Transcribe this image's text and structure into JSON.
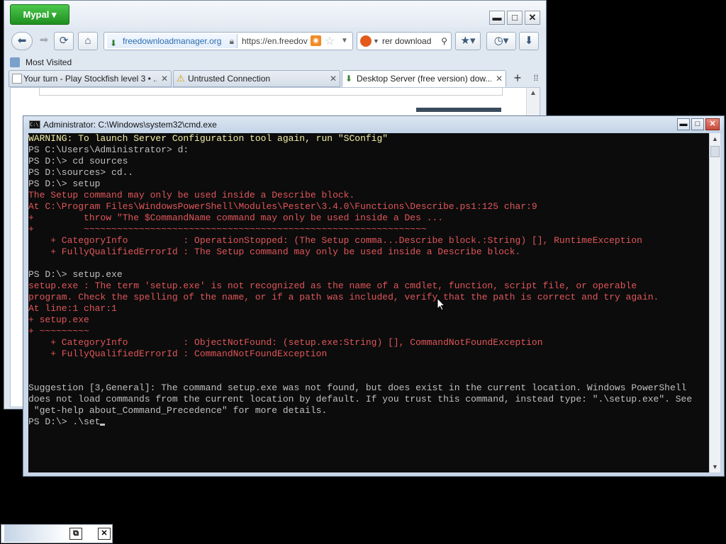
{
  "browser": {
    "app_button": "Mypal",
    "nav": {
      "site_label": "freedownloadmanager.org",
      "url": "https://en.freedov",
      "search_text": "rer download"
    },
    "bookmarks_toolbar": {
      "most_visited": "Most Visited"
    },
    "tabs": [
      {
        "label": "Your turn - Play Stockfish level 3 • ..."
      },
      {
        "label": "Untrusted Connection"
      },
      {
        "label": "Desktop Server (free version) dow..."
      }
    ],
    "new_tab_symbol": "+",
    "window_controls": {
      "minimize": "▬",
      "maximize": "□",
      "close": "✕"
    }
  },
  "cmd": {
    "title": "Administrator: C:\\Windows\\system32\\cmd.exe",
    "window_controls": {
      "minimize": "▬",
      "maximize": "□",
      "close": "✕"
    },
    "lines": [
      {
        "text": "WARNING: To launch Server Configuration tool again, run \"SConfig\"",
        "color": "yellow"
      },
      {
        "text": "PS C:\\Users\\Administrator> d:",
        "color": "white"
      },
      {
        "text": "PS D:\\> cd sources",
        "color": "white"
      },
      {
        "text": "PS D:\\sources> cd..",
        "color": "white"
      },
      {
        "text": "PS D:\\> setup",
        "color": "white"
      },
      {
        "text": "The Setup command may only be used inside a Describe block.",
        "color": "red"
      },
      {
        "text": "At C:\\Program Files\\WindowsPowerShell\\Modules\\Pester\\3.4.0\\Functions\\Describe.ps1:125 char:9",
        "color": "red"
      },
      {
        "text": "+         throw \"The $CommandName command may only be used inside a Des ...",
        "color": "red"
      },
      {
        "text": "+         ~~~~~~~~~~~~~~~~~~~~~~~~~~~~~~~~~~~~~~~~~~~~~~~~~~~~~~~~~~~~~~",
        "color": "red"
      },
      {
        "text": "    + CategoryInfo          : OperationStopped: (The Setup comma...Describe block.:String) [], RuntimeException",
        "color": "red"
      },
      {
        "text": "    + FullyQualifiedErrorId : The Setup command may only be used inside a Describe block.",
        "color": "red"
      },
      {
        "text": "",
        "color": "white"
      },
      {
        "text": "PS D:\\> setup.exe",
        "color": "white"
      },
      {
        "text": "setup.exe : The term 'setup.exe' is not recognized as the name of a cmdlet, function, script file, or operable",
        "color": "red"
      },
      {
        "text": "program. Check the spelling of the name, or if a path was included, verify that the path is correct and try again.",
        "color": "red"
      },
      {
        "text": "At line:1 char:1",
        "color": "red"
      },
      {
        "text": "+ setup.exe",
        "color": "red"
      },
      {
        "text": "+ ~~~~~~~~~",
        "color": "red"
      },
      {
        "text": "    + CategoryInfo          : ObjectNotFound: (setup.exe:String) [], CommandNotFoundException",
        "color": "red"
      },
      {
        "text": "    + FullyQualifiedErrorId : CommandNotFoundException",
        "color": "red"
      },
      {
        "text": "",
        "color": "white"
      },
      {
        "text": "",
        "color": "white"
      },
      {
        "text": "Suggestion [3,General]: The command setup.exe was not found, but does exist in the current location. Windows PowerShell",
        "color": "white"
      },
      {
        "text": "does not load commands from the current location by default. If you trust this command, instead type: \".\\setup.exe\". See",
        "color": "white"
      },
      {
        "text": " \"get-help about_Command_Precedence\" for more details.",
        "color": "white"
      }
    ],
    "prompt": "PS D:\\> .\\set",
    "colors": {
      "white": "#c0c0c0",
      "yellow": "#f4f0a8",
      "red": "#e0565a",
      "background": "#0c0c0c"
    }
  },
  "minimized_window": {
    "restore": "⧉",
    "close": "✕"
  }
}
